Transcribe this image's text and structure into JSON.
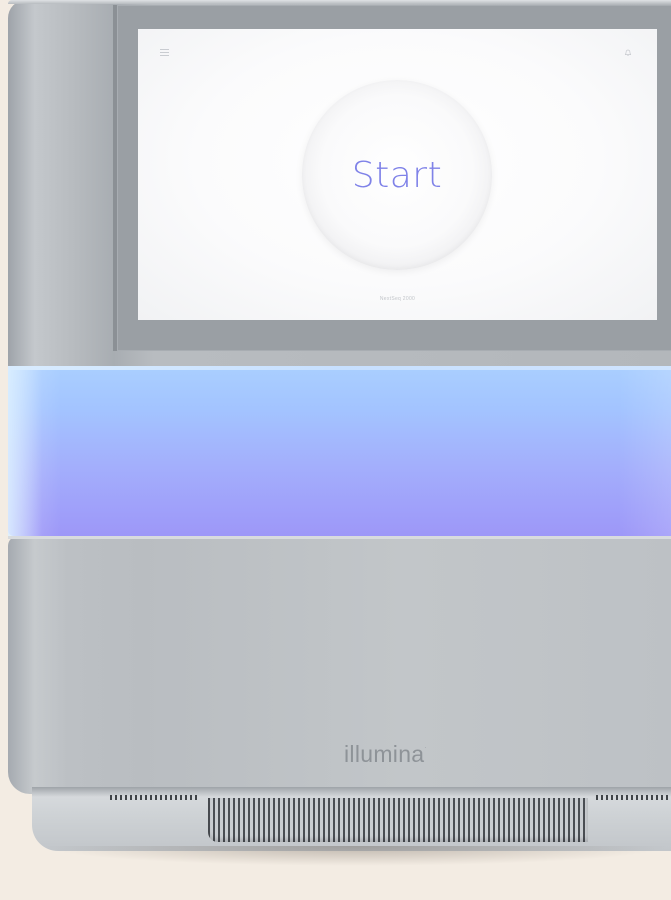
{
  "screen": {
    "start_label": "Start",
    "device_name": "NextSeq 2000",
    "menu_icon": "menu-icon",
    "bell_icon": "bell-icon",
    "accent_color": "#7f82e8"
  },
  "housing": {
    "brand": "illumina",
    "glow_color": "#a3b6fd"
  }
}
